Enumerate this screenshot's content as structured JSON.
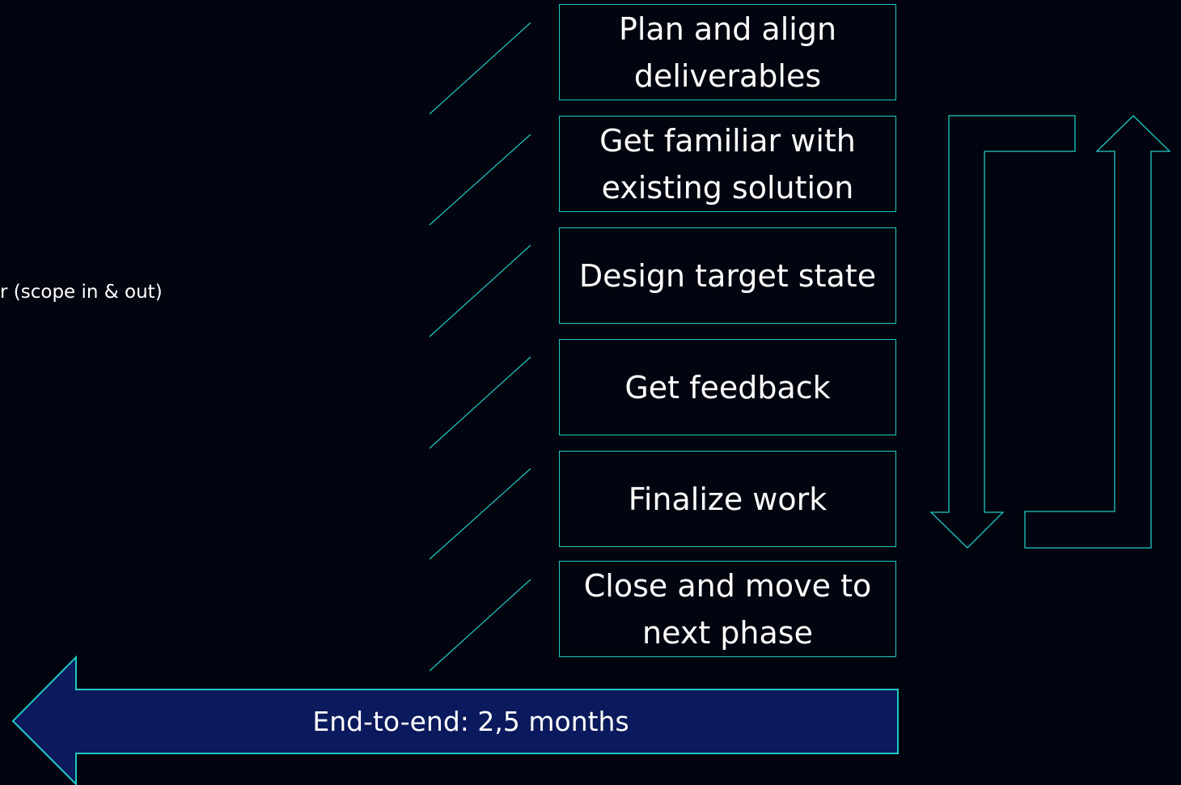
{
  "steps": [
    {
      "label": "Plan and align deliverables"
    },
    {
      "label": "Get familiar with existing solution"
    },
    {
      "label": "Design target state"
    },
    {
      "label": "Get feedback"
    },
    {
      "label": "Finalize work"
    },
    {
      "label": "Close and move to next phase"
    }
  ],
  "side_note": "r (scope in & out)",
  "duration": "End-to-end: 2,5 months",
  "colors": {
    "background": "#02050f",
    "outline": "#1fc9c4",
    "arrow_fill": "#0b1a5c",
    "text": "#ffffff"
  }
}
